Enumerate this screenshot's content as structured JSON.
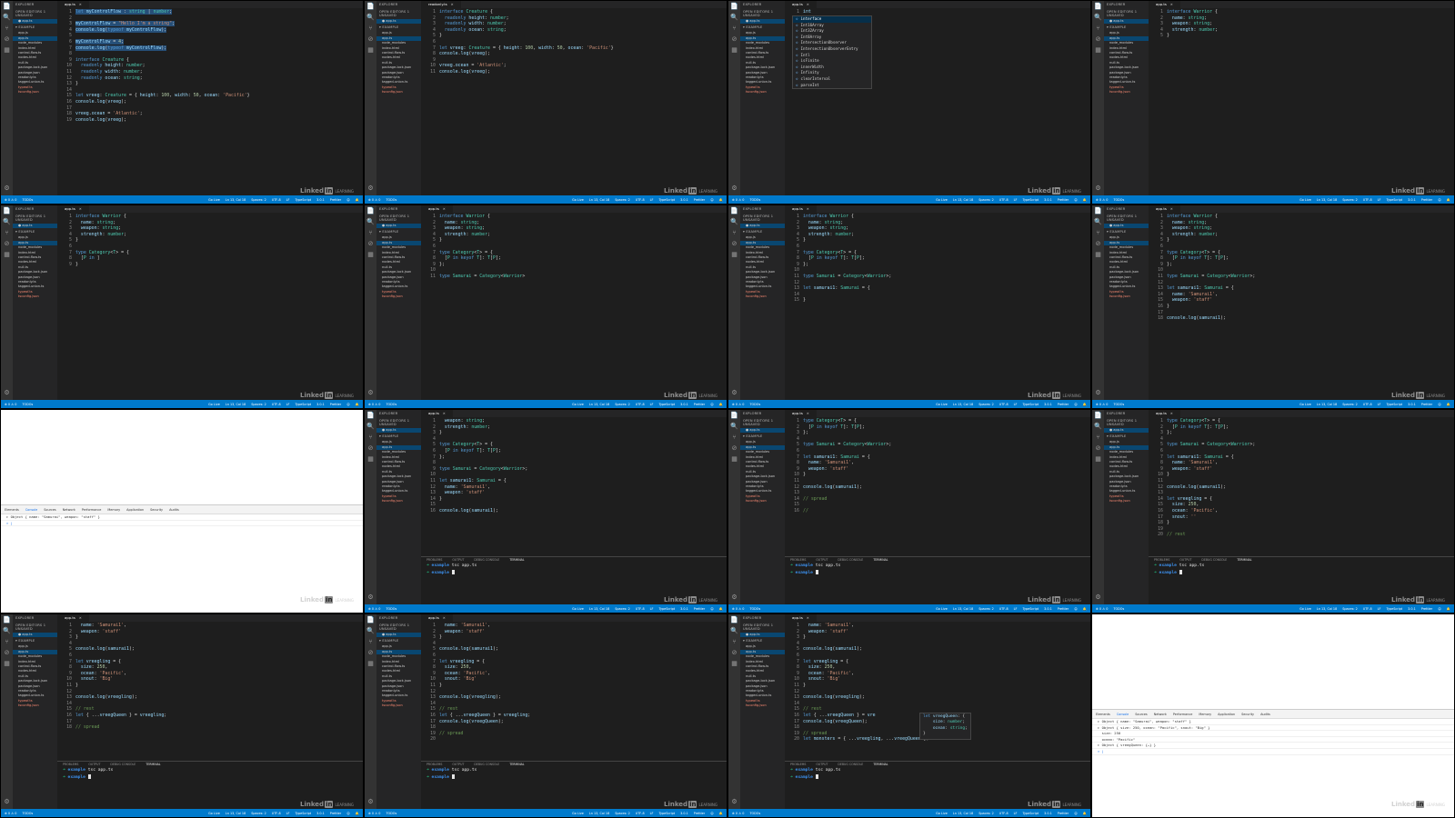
{
  "window": {
    "sidebar_title": "EXPLORER",
    "open_editors": "OPEN EDITORS  1 UNSAVED",
    "project": "EXAMPLE",
    "files": [
      "app.js",
      "app.ts",
      "node_modules",
      "index.html",
      "control-flow.ts",
      "nodes.html",
      "null.ts",
      "package-lock.json",
      "package.json",
      "readonly.ts",
      "tagged-union.ts",
      "typeof.ts",
      "tsconfig.json"
    ],
    "active_file": "app.ts",
    "watermark": "Linked",
    "watermark_in": "in",
    "watermark_sub": "LEARNING",
    "panel_tabs": [
      "PROBLEMS",
      "OUTPUT",
      "DEBUG CONSOLE",
      "TERMINAL"
    ],
    "status_left": [
      "⊗ 0 ⚠ 0",
      "TODOs"
    ],
    "status_right": [
      "Go Live",
      "Ln 13, Col 18",
      "Spaces: 2",
      "UTF-8",
      "LF",
      "TypeScript",
      "3.0.1",
      "Prettier",
      "☺",
      "🔔"
    ]
  },
  "devtools": {
    "tabs": [
      "Elements",
      "Console",
      "Sources",
      "Network",
      "Performance",
      "Memory",
      "Application",
      "Security",
      "Audits"
    ],
    "console_lines": [
      "▸ Object { name: \"Samurai\", weapon: \"staff\" }",
      "▸ Object { size: 250, ocean: \"Pacific\", snout: \"Big\" }",
      "  size: 250",
      "  ocean: \"Pacific\"",
      "▸ Object { vreegQueen: {…} }",
      "> |"
    ]
  },
  "frames": [
    {
      "kind": "code",
      "tab": "app.ts",
      "lines": [
        "let myControlFlow : string | number;",
        "",
        "myControlFlow = \"Hello I'm a string\";",
        "console.log(typeof myControlFlow);",
        "",
        "myControlFlow = 4;",
        "console.log(typeof myControlFlow);",
        "",
        "interface Creature {",
        "  readonly height: number;",
        "  readonly width: number;",
        "  readonly ocean: string;",
        "}",
        "",
        "let vreeg: Creature = { height: 100, width: 50, ocean: 'Pacific'}",
        "console.log(vreeg);",
        "",
        "vreeg.ocean = 'Atlantic';",
        "console.log(vreeg);"
      ],
      "hl": [
        0,
        1,
        2,
        3,
        4,
        5,
        6
      ]
    },
    {
      "kind": "code",
      "tab": "readonly.ts",
      "lines": [
        "interface Creature {",
        "  readonly height: number;",
        "  readonly width: number;",
        "  readonly ocean: string;",
        "}",
        "",
        "let vreeg: Creature = { height: 100, width: 50, ocean: 'Pacific'}",
        "console.log(vreeg);",
        "",
        "vreeg.ocean = 'Atlantic';",
        "console.log(vreeg);"
      ],
      "hl": []
    },
    {
      "kind": "suggest",
      "tab": "app.ts",
      "lines": [
        "int"
      ],
      "hl": [],
      "suggest": [
        "interface",
        "Int16Array",
        "Int32Array",
        "Int8Array",
        "IntersectionObserver",
        "IntersectionObserverEntry",
        "Intl",
        "isFinite",
        "innerWidth",
        "Infinity",
        "clearInterval",
        "parseInt"
      ]
    },
    {
      "kind": "code",
      "tab": "app.ts",
      "lines": [
        "interface Warrior {",
        "  name: string;",
        "  weapon: string;",
        "  strength: number;",
        "}"
      ],
      "hl": []
    },
    {
      "kind": "code",
      "tab": "app.ts",
      "lines": [
        "interface Warrior {",
        "  name: string;",
        "  weapon: string;",
        "  strength: number;",
        "}",
        "",
        "type Category<T> = {",
        "  [P in ]",
        "}"
      ],
      "hl": []
    },
    {
      "kind": "code",
      "tab": "app.ts",
      "lines": [
        "interface Warrior {",
        "  name: string;",
        "  weapon: string;",
        "  strength: number;",
        "}",
        "",
        "type Category<T> = {",
        "  [P in keyof T]: T[P];",
        "};",
        "",
        "type Samurai = Category<Warrior>"
      ],
      "hl": []
    },
    {
      "kind": "code",
      "tab": "app.ts",
      "lines": [
        "interface Warrior {",
        "  name: string;",
        "  weapon: string;",
        "  strength: number;",
        "}",
        "",
        "type Category<T> = {",
        "  [P in keyof T]: T[P];",
        "};",
        "",
        "type Samurai = Category<Warrior>;",
        "",
        "let samurai1: Samurai = {",
        "",
        "}"
      ],
      "hl": []
    },
    {
      "kind": "code",
      "tab": "app.ts",
      "lines": [
        "interface Warrior {",
        "  name: string;",
        "  weapon: string;",
        "  strength: number;",
        "}",
        "",
        "type Category<T> = {",
        "  [P in keyof T]: T[P];",
        "};",
        "",
        "type Samurai = Category<Warrior>;",
        "",
        "let samurai1: Samurai = {",
        "  name: 'Samurai1',",
        "  weapon: 'staff'",
        "}",
        "",
        "console.log(samurai1);"
      ],
      "hl": []
    },
    {
      "kind": "devtools"
    },
    {
      "kind": "term",
      "tab": "app.ts",
      "lines": [
        "  weapon: string;",
        "  strength: number;",
        "}",
        "",
        "type Category<T> = {",
        "  [P in keyof T]: T[P];",
        "};",
        "",
        "type Samurai = Category<Warrior>;",
        "",
        "let samurai1: Samurai = {",
        "  name: 'Samurai1',",
        "  weapon: 'staff'",
        "}",
        "",
        "console.log(samurai1);"
      ],
      "hl": [],
      "term": [
        "example tsc app.ts",
        "example "
      ]
    },
    {
      "kind": "term",
      "tab": "app.ts",
      "lines": [
        "type Category<T> = {",
        "  [P in keyof T]: T[P];",
        "};",
        "",
        "type Samurai = Category<Warrior>;",
        "",
        "let samurai1: Samurai = {",
        "  name: 'Samurai1',",
        "  weapon: 'staff'",
        "}",
        "",
        "console.log(samurai1);",
        "",
        "// spread",
        "",
        "//"
      ],
      "hl": [],
      "term": [
        "example tsc app.ts",
        "example "
      ]
    },
    {
      "kind": "term",
      "tab": "app.ts",
      "lines": [
        "type Category<T> = {",
        "  [P in keyof T]: T[P];",
        "};",
        "",
        "type Samurai = Category<Warrior>;",
        "",
        "let samurai1: Samurai = {",
        "  name: 'Samurai1',",
        "  weapon: 'staff'",
        "}",
        "",
        "console.log(samurai1);",
        "",
        "let vreegling = {",
        "  size: 250,",
        "  ocean: 'Pacific',",
        "  snout: ''",
        "}",
        "",
        "// rest"
      ],
      "hl": [],
      "term": [
        "example tsc app.ts",
        "example "
      ]
    },
    {
      "kind": "term",
      "tab": "app.ts",
      "lines": [
        "  name: 'Samurai1',",
        "  weapon: 'staff'",
        "}",
        "",
        "console.log(samurai1);",
        "",
        "let vreegling = {",
        "  size: 250,",
        "  ocean: 'Pacific',",
        "  snout: 'Big'",
        "}",
        "",
        "console.log(vreegling);",
        "",
        "// rest",
        "let { ...vreegQueen } = vreegling;",
        "",
        "// spread"
      ],
      "hl": [],
      "term": [
        "example tsc app.ts",
        "example "
      ]
    },
    {
      "kind": "term",
      "tab": "app.ts",
      "lines": [
        "  name: 'Samurai1',",
        "  weapon: 'staff'",
        "}",
        "",
        "console.log(samurai1);",
        "",
        "let vreegling = {",
        "  size: 250,",
        "  ocean: 'Pacific',",
        "  snout: 'Big'",
        "}",
        "",
        "console.log(vreegling);",
        "",
        "// rest",
        "let { ...vreegQueen } = vreegling;",
        "console.log(vreegQueen);",
        "",
        "// spread",
        ""
      ],
      "hl": [],
      "term": [
        "example tsc app.ts",
        "example "
      ]
    },
    {
      "kind": "hover",
      "tab": "app.ts",
      "lines": [
        "  name: 'Samurai1',",
        "  weapon: 'staff'",
        "}",
        "",
        "console.log(samurai1);",
        "",
        "let vreegling = {",
        "  size: 250,",
        "  ocean: 'Pacific',",
        "  snout: 'Big'",
        "}",
        "",
        "console.log(vreegling);",
        "",
        "// rest",
        "let { ...vreegQueen } = vre",
        "console.log(vreegQueen);",
        "",
        "// spread",
        "let monsters = { ...vreegling, ...vreegQueen };"
      ],
      "hl": [],
      "term": [
        "example tsc app.ts",
        "example "
      ],
      "hover": [
        "let vreegQueen: {",
        "    size: number;",
        "    ocean: string;",
        "}"
      ]
    },
    {
      "kind": "devtools"
    }
  ]
}
